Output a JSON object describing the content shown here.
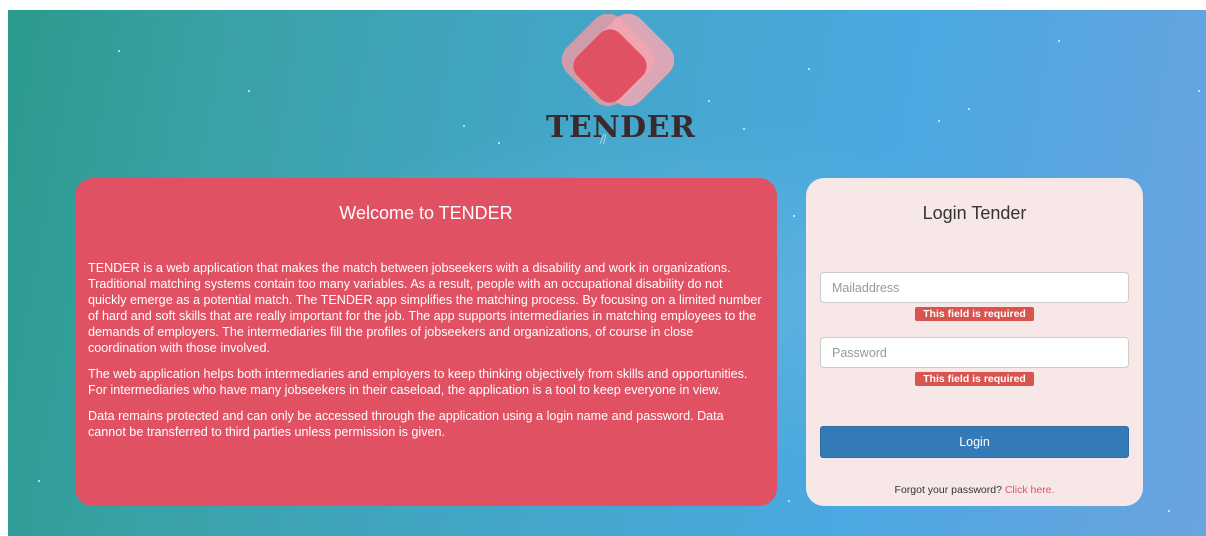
{
  "logo": {
    "text": "TENDER"
  },
  "welcome": {
    "title": "Welcome to TENDER",
    "paragraphs": [
      "TENDER is a web application that makes the match between jobseekers with a disability and work in organizations. Traditional matching systems contain too many variables. As a result, people with an occupational disability do not quickly emerge as a potential match. The TENDER app simplifies the matching process. By focusing on a limited number of hard and soft skills that are really important for the job. The app supports intermediaries in matching employees to the demands of employers. The intermediaries fill the profiles of jobseekers and organizations, of course in close coordination with those involved.",
      "The web application helps both intermediaries and employers to keep thinking objectively from skills and opportunities. For intermediaries who have many jobseekers in their caseload, the application is a tool to keep everyone in view.",
      "Data remains protected and can only be accessed through the application using a login name and password. Data cannot be transferred to third parties unless permission is given."
    ]
  },
  "login": {
    "title": "Login Tender",
    "email": {
      "value": "",
      "placeholder": "Mailaddress",
      "error": "This field is required"
    },
    "password": {
      "value": "",
      "placeholder": "Password",
      "error": "This field is required"
    },
    "submit_label": "Login",
    "forgot_text": "Forgot your password?",
    "forgot_link": "Click here."
  },
  "colors": {
    "panel_red": "#e05263",
    "panel_pink": "#f7e8e7",
    "button_blue": "#337ab7",
    "error_red": "#d9534f"
  }
}
